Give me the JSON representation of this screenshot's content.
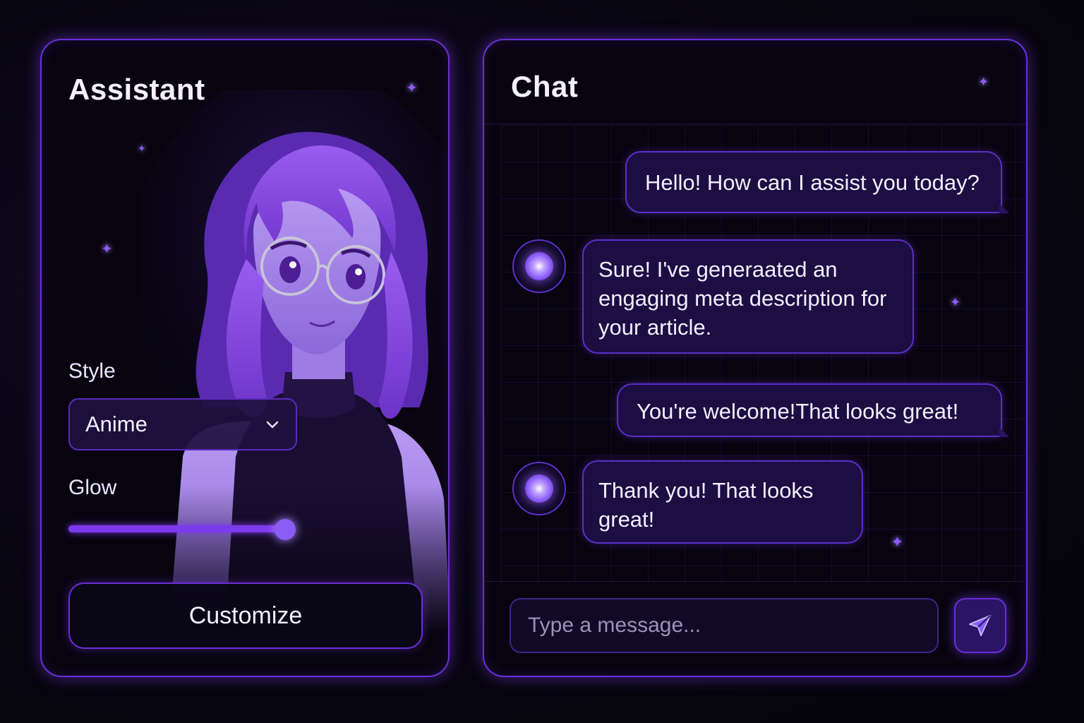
{
  "assistant_panel": {
    "title": "Assistant",
    "style_label": "Style",
    "style_selected": "Anime",
    "glow_label": "Glow",
    "glow_level": 0.96,
    "customize_label": "Customize"
  },
  "chat_panel": {
    "title": "Chat",
    "messages": [
      {
        "sender": "user",
        "text": "Hello! How can I assist you today?"
      },
      {
        "sender": "assistant",
        "text": "Sure! I've generaated an engaging meta description for your article."
      },
      {
        "sender": "user",
        "text": "You're welcome!That looks great!"
      },
      {
        "sender": "assistant",
        "text": "Thank you! That looks great!"
      }
    ],
    "input_placeholder": "Type a message...",
    "send_icon": "send-icon"
  },
  "colors": {
    "accent": "#7c3aed",
    "panel_border": "#6a2fd6",
    "bubble_bg": "#1e0f46",
    "background": "#07050f"
  }
}
